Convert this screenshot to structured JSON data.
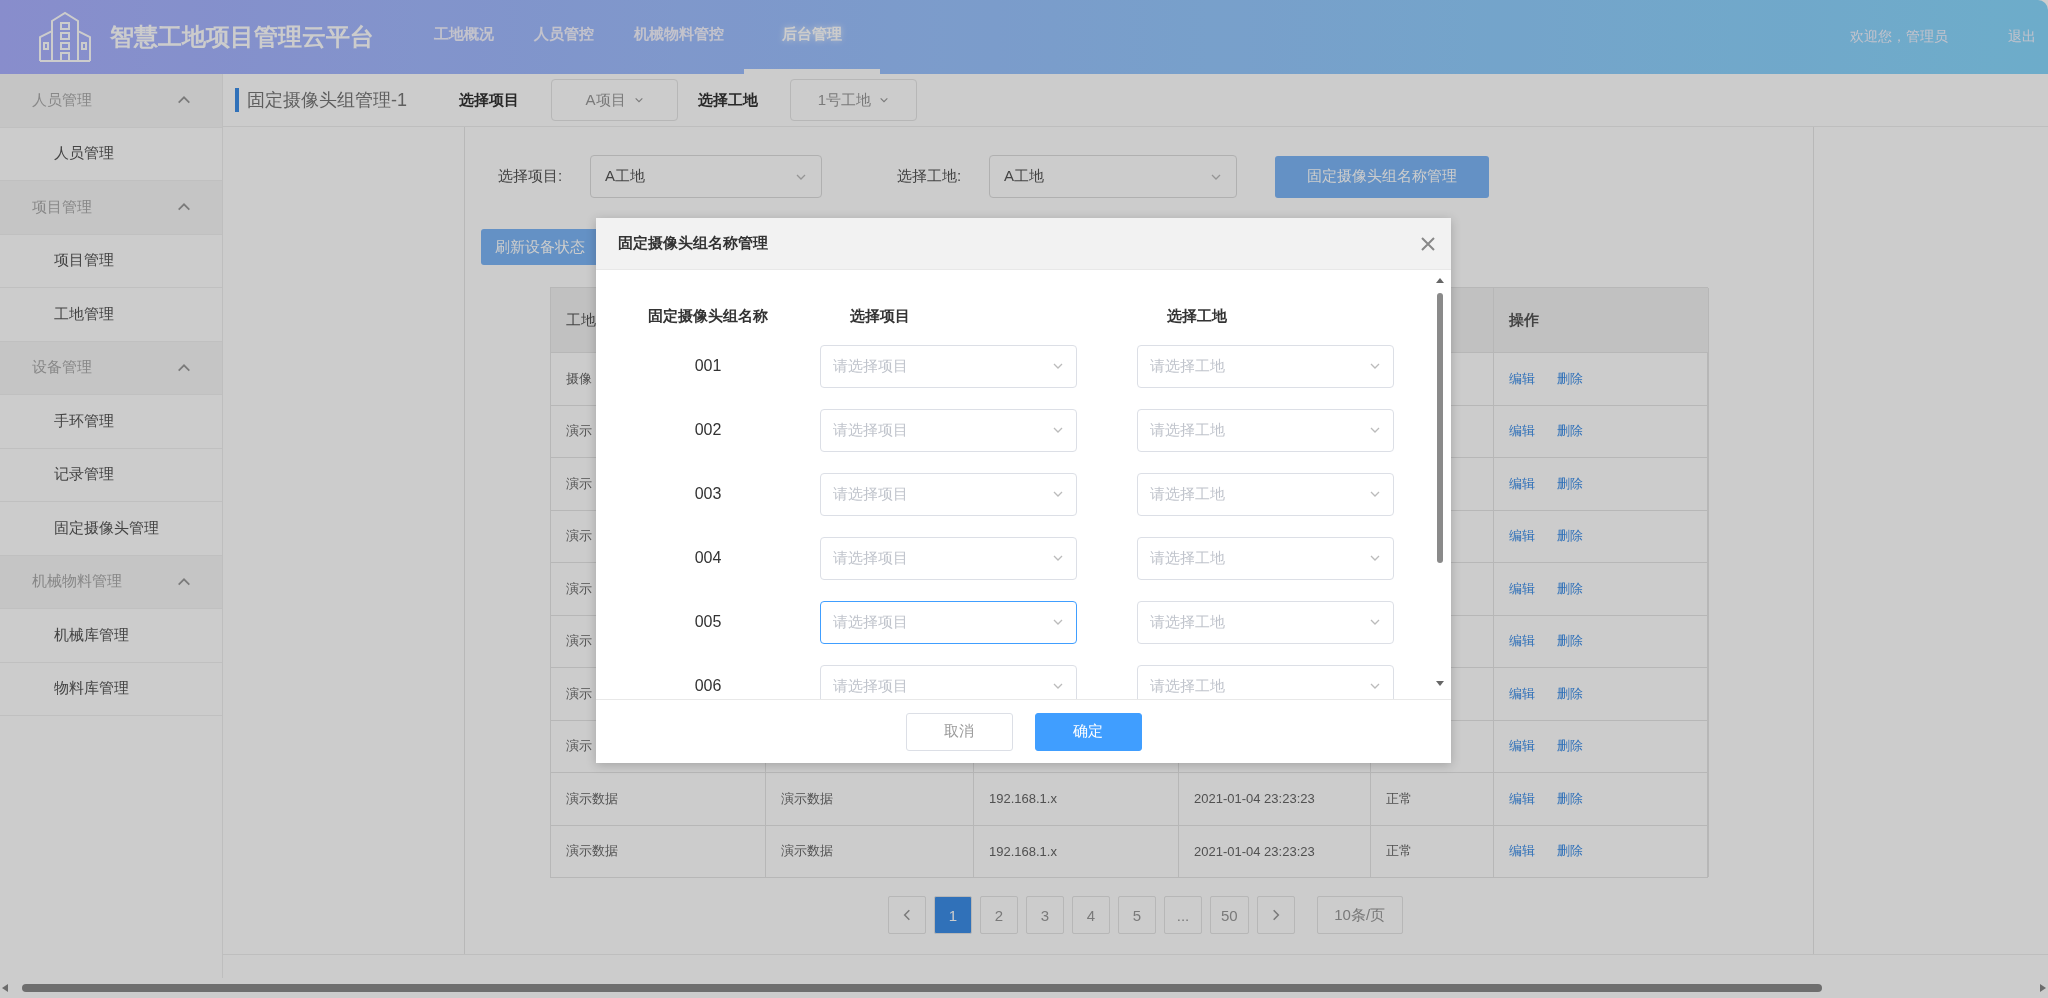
{
  "header": {
    "title": "智慧工地项目管理云平台",
    "nav": [
      {
        "label": "工地概况",
        "selected": false
      },
      {
        "label": "人员管控",
        "selected": false
      },
      {
        "label": "机械物料管控",
        "selected": false
      },
      {
        "label": "后台管理",
        "selected": true
      }
    ],
    "welcome": "欢迎您，管理员",
    "logout": "退出"
  },
  "sidebar": [
    {
      "label": "人员管理",
      "expanded": true,
      "children": [
        {
          "label": "人员管理"
        }
      ]
    },
    {
      "label": "项目管理",
      "expanded": true,
      "children": [
        {
          "label": "项目管理"
        },
        {
          "label": "工地管理"
        }
      ]
    },
    {
      "label": "设备管理",
      "expanded": true,
      "children": [
        {
          "label": "手环管理"
        },
        {
          "label": "记录管理"
        },
        {
          "label": "固定摄像头管理"
        }
      ]
    },
    {
      "label": "机械物料管理",
      "expanded": true,
      "children": [
        {
          "label": "机械库管理"
        },
        {
          "label": "物料库管理"
        }
      ]
    }
  ],
  "topbar": {
    "title": "固定摄像头组管理-1",
    "filters": [
      {
        "label": "选择项目",
        "value": "A项目"
      },
      {
        "label": "选择工地",
        "value": "1号工地"
      }
    ]
  },
  "filters": [
    {
      "label": "选择项目:",
      "value": "A工地"
    },
    {
      "label": "选择工地:",
      "value": "A工地"
    }
  ],
  "manage_button": "固定摄像头组名称管理",
  "refresh_button": "刷新设备状态",
  "table": {
    "columns": [
      "工地"
    ],
    "actions_header": "操作",
    "rows": [
      {
        "cells": [
          "摄像"
        ],
        "actions": [
          "编辑",
          "删除"
        ]
      },
      {
        "cells": [
          "演示"
        ],
        "actions": [
          "编辑",
          "删除"
        ]
      },
      {
        "cells": [
          "演示"
        ],
        "actions": [
          "编辑",
          "删除"
        ]
      },
      {
        "cells": [
          "演示"
        ],
        "actions": [
          "编辑",
          "删除"
        ]
      },
      {
        "cells": [
          "演示"
        ],
        "actions": [
          "编辑",
          "删除"
        ]
      },
      {
        "cells": [
          "演示"
        ],
        "actions": [
          "编辑",
          "删除"
        ]
      },
      {
        "cells": [
          "演示"
        ],
        "actions": [
          "编辑",
          "删除"
        ]
      },
      {
        "cells": [
          "演示"
        ],
        "actions": [
          "编辑",
          "删除"
        ]
      },
      {
        "cells": [
          "演示数据",
          "演示数据",
          "192.168.1.x",
          "2021-01-04 23:23:23",
          "正常"
        ],
        "actions": [
          "编辑",
          "删除"
        ]
      },
      {
        "cells": [
          "演示数据",
          "演示数据",
          "192.168.1.x",
          "2021-01-04 23:23:23",
          "正常"
        ],
        "actions": [
          "编辑",
          "删除"
        ]
      }
    ]
  },
  "pagination": {
    "pages": [
      {
        "label": "1",
        "selected": true
      },
      {
        "label": "2",
        "selected": false
      },
      {
        "label": "3",
        "selected": false
      },
      {
        "label": "4",
        "selected": false
      },
      {
        "label": "5",
        "selected": false
      },
      {
        "label": "...",
        "selected": false
      },
      {
        "label": "50",
        "selected": false
      }
    ],
    "page_size": "10条/页"
  },
  "dialog": {
    "title": "固定摄像头组名称管理",
    "columns": [
      "固定摄像头组名称",
      "选择项目",
      "选择工地"
    ],
    "rows": [
      {
        "name": "001",
        "project_placeholder": "请选择项目",
        "site_placeholder": "请选择工地",
        "focused": false
      },
      {
        "name": "002",
        "project_placeholder": "请选择项目",
        "site_placeholder": "请选择工地",
        "focused": false
      },
      {
        "name": "003",
        "project_placeholder": "请选择项目",
        "site_placeholder": "请选择工地",
        "focused": false
      },
      {
        "name": "004",
        "project_placeholder": "请选择项目",
        "site_placeholder": "请选择工地",
        "focused": false
      },
      {
        "name": "005",
        "project_placeholder": "请选择项目",
        "site_placeholder": "请选择工地",
        "focused": true
      },
      {
        "name": "006",
        "project_placeholder": "请选择项目",
        "site_placeholder": "请选择工地",
        "focused": false
      }
    ],
    "cancel": "取消",
    "confirm": "确定"
  }
}
